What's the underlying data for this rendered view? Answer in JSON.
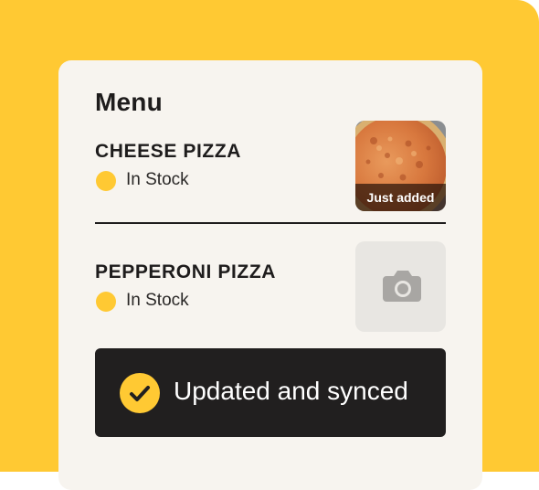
{
  "menu": {
    "title": "Menu",
    "items": [
      {
        "name": "CHEESE PIZZA",
        "status": "In Stock",
        "badge": "Just added"
      },
      {
        "name": "PEPPERONI PIZZA",
        "status": "In Stock"
      }
    ]
  },
  "toast": {
    "message": "Updated and synced"
  },
  "colors": {
    "accent": "#FFC933",
    "card": "#F7F4EF",
    "dark": "#211F1F",
    "placeholder": "#E8E6E2"
  },
  "icons": {
    "status": "status-dot",
    "empty_photo": "camera-icon",
    "toast": "check-circle-icon"
  }
}
